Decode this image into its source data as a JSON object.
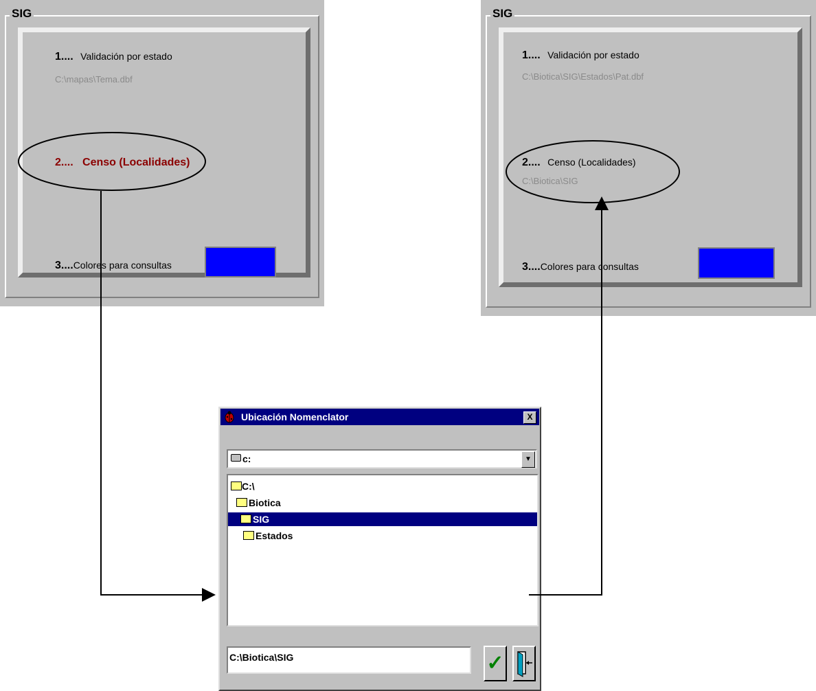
{
  "panel_left": {
    "legend": "SIG",
    "item1_num": "1....",
    "item1_label": "Validación por estado",
    "item1_path": "C:\\mapas\\Tema.dbf",
    "item2_text": "2....   Censo (Localidades)",
    "item3_num": "3....",
    "item3_label": "Colores para consultas"
  },
  "panel_right": {
    "legend": "SIG",
    "item1_num": "1....",
    "item1_label": "Validación por estado",
    "item1_path": "C:\\Biotica\\SIG\\Estados\\Pat.dbf",
    "item2_num": "2....",
    "item2_label": "Censo (Localidades)",
    "item2_path": "C:\\Biotica\\SIG",
    "item3_num": "3....",
    "item3_label": "Colores para consultas"
  },
  "dialog": {
    "title": "Ubicación Nomenclator",
    "close_glyph": "X",
    "drive": "c:",
    "tree": [
      "C:\\",
      "Biotica",
      "SIG",
      "Estados"
    ],
    "path_value": "C:\\Biotica\\SIG",
    "ok_glyph": "✓"
  },
  "colors": {
    "swatch": "#0000ff",
    "highlight": "#8b0000",
    "titlebar": "#000080"
  }
}
